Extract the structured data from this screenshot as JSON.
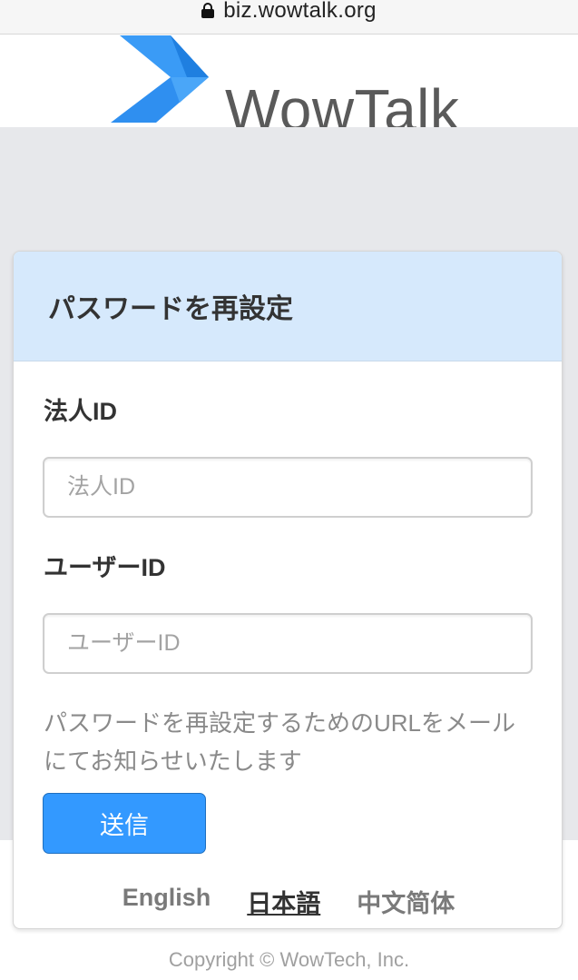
{
  "browser": {
    "url": "biz.wowtalk.org"
  },
  "header": {
    "logo_text": "WowTalk",
    "logo_color": "#2f8ff0"
  },
  "card": {
    "title": "パスワードを再設定",
    "corp_id": {
      "label": "法人ID",
      "placeholder": "法人ID",
      "value": ""
    },
    "user_id": {
      "label": "ユーザーID",
      "placeholder": "ユーザーID",
      "value": ""
    },
    "note": "パスワードを再設定するためのURLをメールにてお知らせいたします",
    "submit_label": "送信",
    "languages": [
      {
        "label": "English",
        "active": false
      },
      {
        "label": "日本語",
        "active": true
      },
      {
        "label": "中文简体",
        "active": false
      }
    ]
  },
  "footer": {
    "copyright": "Copyright © WowTech, Inc."
  },
  "colors": {
    "accent": "#3399ff",
    "card_header_bg": "#d6e9fc",
    "page_bg": "#e7e8eb"
  }
}
